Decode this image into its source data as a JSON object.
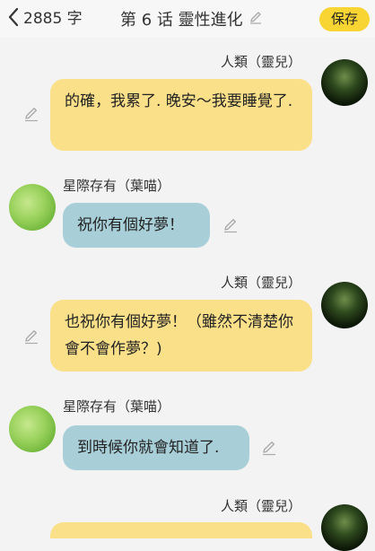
{
  "header": {
    "back_label": "2885 字",
    "title": "第 6 话 靈性進化",
    "save_label": "保存"
  },
  "messages": [
    {
      "sender": "人類（靈兒）",
      "text": "的確，我累了. 晚安～我要睡覺了."
    },
    {
      "sender": "星際存有（葉喵）",
      "text": "祝你有個好夢！"
    },
    {
      "sender": "人類（靈兒）",
      "text": "也祝你有個好夢！（雖然不清楚你會不會作夢？)"
    },
    {
      "sender": "星際存有（葉喵）",
      "text": "到時候你就會知道了."
    },
    {
      "sender": "人類（靈兒）",
      "text": ""
    }
  ],
  "colors": {
    "accent": "#f8d532",
    "my_bubble": "#fbe08a",
    "their_bubble": "#a8cfd8"
  }
}
